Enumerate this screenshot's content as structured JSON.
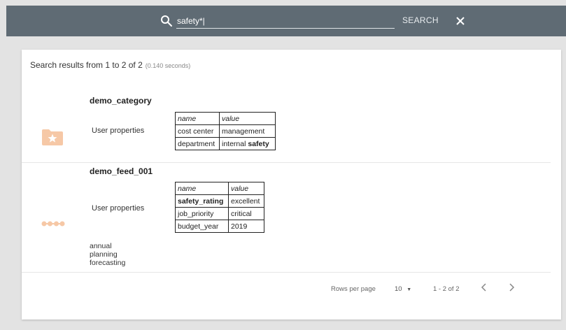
{
  "search": {
    "value": "safety*|",
    "button_label": "SEARCH"
  },
  "summary": {
    "text": "Search results from 1 to 2 of 2",
    "time": "(0.140 seconds)"
  },
  "results": [
    {
      "title": "demo_category",
      "icon": "category-folder-star-icon",
      "props_label": "User properties",
      "headers": [
        "name",
        "value"
      ],
      "rows": [
        [
          "cost center",
          "management"
        ],
        [
          "department",
          "internal ",
          "safety"
        ]
      ]
    },
    {
      "title": "demo_feed_001",
      "icon": "feed-dots-icon",
      "props_label": "User properties",
      "headers": [
        "name",
        "value"
      ],
      "rows": [
        [
          "safety_rating",
          "excellent"
        ],
        [
          "job_priority",
          "critical"
        ],
        [
          "budget_year",
          "2019"
        ]
      ],
      "tags": [
        "annual",
        "planning",
        "forecasting"
      ]
    }
  ],
  "pagination": {
    "rows_per_page_label": "Rows per page",
    "rows_per_page_value": "10",
    "range": "1 - 2 of 2"
  },
  "colors": {
    "topbar": "#5f6b74",
    "icon_accent": "#f6c8a6"
  }
}
